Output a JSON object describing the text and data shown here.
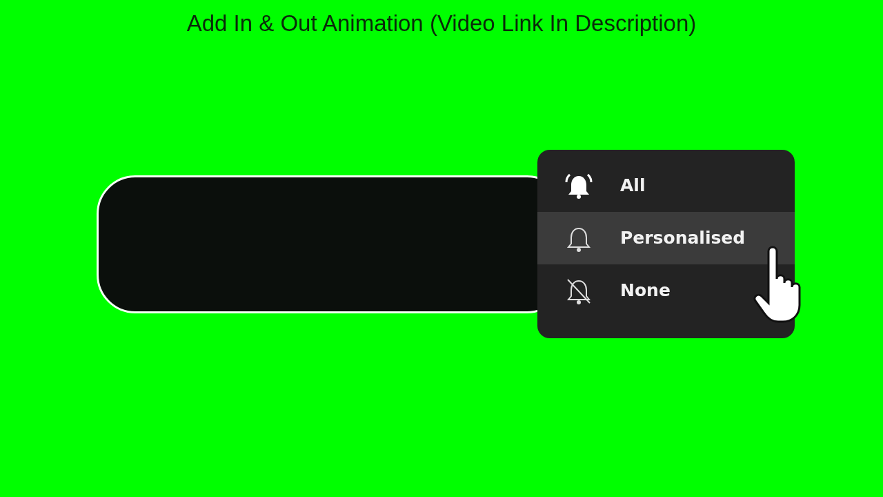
{
  "title": "Add In & Out Animation (Video Link In Description)",
  "menu": {
    "items": [
      {
        "label": "All",
        "kind": "ringing",
        "selected": false
      },
      {
        "label": "Personalised",
        "kind": "outline",
        "selected": true
      },
      {
        "label": "None",
        "kind": "off",
        "selected": false
      }
    ]
  }
}
